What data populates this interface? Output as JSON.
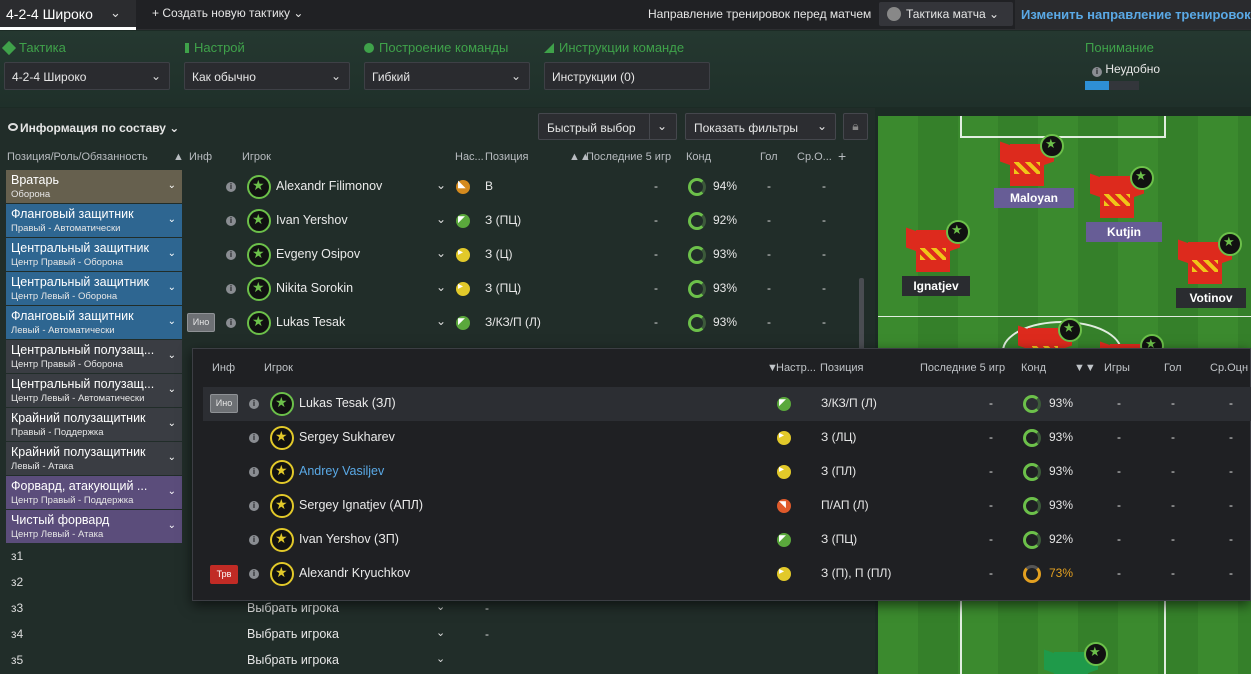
{
  "topbar": {
    "tactic_name": "4-2-4 Широко",
    "new_tactic": "+ Создать новую тактику",
    "training_direction": "Направление тренировок перед матчем",
    "match_tactic": "Тактика матча",
    "change_training": "Изменить направление тренировок п"
  },
  "settings": {
    "tactic": {
      "title": "Тактика",
      "value": "4-2-4 Широко"
    },
    "mentality": {
      "title": "Настрой",
      "value": "Как обычно"
    },
    "formation": {
      "title": "Построение команды",
      "value": "Гибкий"
    },
    "instructions": {
      "title": "Инструкции команде",
      "value": "Инструкции (0)"
    },
    "understanding": {
      "title": "Понимание",
      "value": "Неудобно",
      "level": 0.45
    }
  },
  "panel": {
    "info_select": "Информация по составу",
    "quick_pick": "Быстрый выбор",
    "show_filters": "Показать фильтры"
  },
  "columns": {
    "position_role": "Позиция/Роль/Обязанность",
    "info": "Инф",
    "player": "Игрок",
    "mood": "Нас...",
    "position": "Позиция",
    "last5": "Последние 5 игр",
    "condition": "Конд",
    "goals": "Гол",
    "avg_rating": "Ср.О..."
  },
  "rows": [
    {
      "role": "Вратарь",
      "duty": "Оборона",
      "player": "Alexandr Filimonov",
      "pos": "В",
      "last5": "-",
      "cond": "94%",
      "goals": "-",
      "rating": "-",
      "ino": ""
    },
    {
      "role": "Фланговый защитник",
      "duty": "Правый - Автоматически",
      "player": "Ivan Yershov",
      "pos": "З (ПЦ)",
      "last5": "-",
      "cond": "92%",
      "goals": "-",
      "rating": "-",
      "ino": ""
    },
    {
      "role": "Центральный защитник",
      "duty": "Центр Правый - Оборона",
      "player": "Evgeny Osipov",
      "pos": "З (Ц)",
      "last5": "-",
      "cond": "93%",
      "goals": "-",
      "rating": "-",
      "ino": ""
    },
    {
      "role": "Центральный защитник",
      "duty": "Центр Левый - Оборона",
      "player": "Nikita Sorokin",
      "pos": "З (ПЦ)",
      "last5": "-",
      "cond": "93%",
      "goals": "-",
      "rating": "-",
      "ino": ""
    },
    {
      "role": "Фланговый защитник",
      "duty": "Левый - Автоматически",
      "player": "Lukas Tesak",
      "pos": "З/КЗ/П (Л)",
      "last5": "-",
      "cond": "93%",
      "goals": "-",
      "rating": "-",
      "ino": "Ино"
    },
    {
      "role": "Центральный полузащ...",
      "duty": "Центр Правый - Оборона"
    },
    {
      "role": "Центральный полузащ...",
      "duty": "Центр Левый - Автоматически"
    },
    {
      "role": "Крайний полузащитник",
      "duty": "Правый - Поддержка"
    },
    {
      "role": "Крайний полузащитник",
      "duty": "Левый - Атака"
    },
    {
      "role": "Форвард, атакующий ...",
      "duty": "Центр Правый - Поддержка"
    },
    {
      "role": "Чистый форвард",
      "duty": "Центр Левый - Атака"
    }
  ],
  "subs": [
    {
      "label": "з1",
      "pick": ""
    },
    {
      "label": "з2",
      "pick": ""
    },
    {
      "label": "з3",
      "pick": "Выбрать игрока",
      "dash": "-"
    },
    {
      "label": "з4",
      "pick": "Выбрать игрока",
      "dash": "-"
    },
    {
      "label": "з5",
      "pick": "Выбрать игрока"
    }
  ],
  "pitch": {
    "players": [
      "Maloyan",
      "Kutjin",
      "Ignatjev",
      "Votinov"
    ]
  },
  "popup": {
    "columns": {
      "info": "Инф",
      "player": "Игрок",
      "mood": "Настр...",
      "position": "Позиция",
      "last5": "Последние 5 игр",
      "condition": "Конд",
      "games": "Игры",
      "goals": "Гол",
      "avg_rating": "Ср.Оцн"
    },
    "rows": [
      {
        "badge": "Ино",
        "name": "Lukas Tesak (ЗЛ)",
        "pos": "З/КЗ/П (Л)",
        "last5": "-",
        "cond": "93%",
        "games": "-",
        "goals": "-",
        "rating": "-"
      },
      {
        "badge": "",
        "name": "Sergey Sukharev",
        "pos": "З (ЛЦ)",
        "last5": "-",
        "cond": "93%",
        "games": "-",
        "goals": "-",
        "rating": "-"
      },
      {
        "badge": "",
        "name": "Andrey Vasiljev",
        "pos": "З (ПЛ)",
        "last5": "-",
        "cond": "93%",
        "games": "-",
        "goals": "-",
        "rating": "-"
      },
      {
        "badge": "",
        "name": "Sergey Ignatjev (АПЛ)",
        "pos": "П/АП (Л)",
        "last5": "-",
        "cond": "93%",
        "games": "-",
        "goals": "-",
        "rating": "-"
      },
      {
        "badge": "",
        "name": "Ivan Yershov (ЗП)",
        "pos": "З (ПЦ)",
        "last5": "-",
        "cond": "92%",
        "games": "-",
        "goals": "-",
        "rating": "-"
      },
      {
        "badge": "Трв",
        "name": "Alexandr Kryuchkov",
        "pos": "З (П), П (ПЛ)",
        "last5": "-",
        "cond": "73%",
        "games": "-",
        "goals": "-",
        "rating": "-"
      }
    ]
  },
  "colors": {
    "accent_green": "#3fa24a",
    "link_blue": "#5aa9e6",
    "injury_red": "#c12b25"
  }
}
